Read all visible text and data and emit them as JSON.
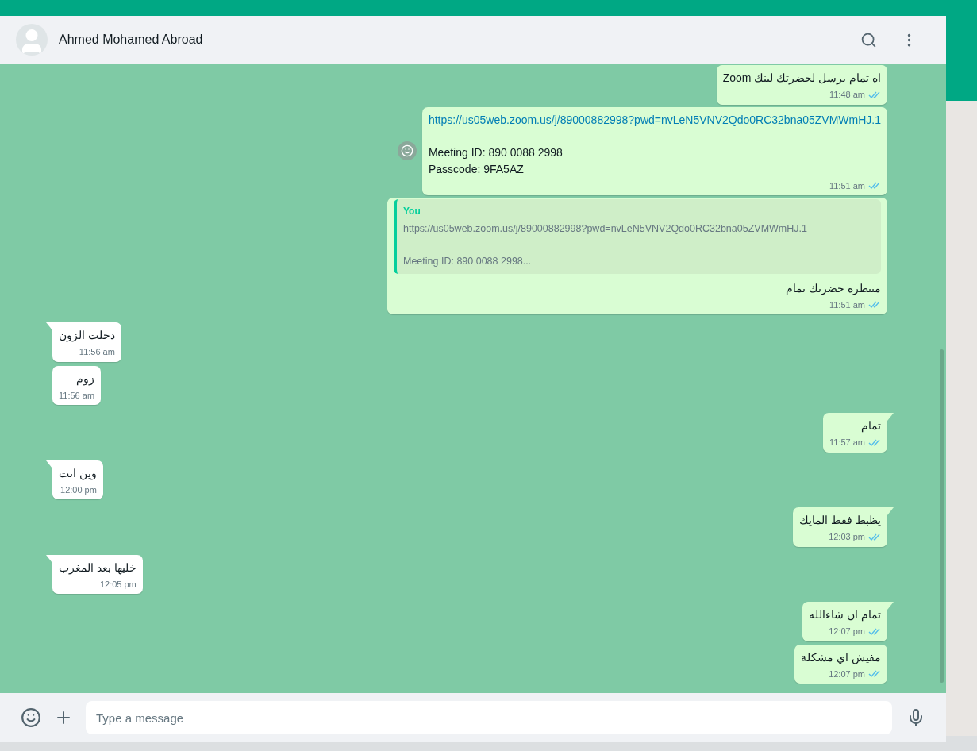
{
  "header": {
    "contact_name": "Ahmed Mohamed Abroad"
  },
  "messages": [
    {
      "kind": "text",
      "outgoing": true,
      "tail": false,
      "text": "اه تمام برسل لحضرتك لينك Zoom",
      "time": "11:48 am",
      "read": true
    },
    {
      "kind": "link",
      "outgoing": true,
      "tail": false,
      "link": "https://us05web.zoom.us/j/89000882998?pwd=nvLeN5VNV2Qdo0RC32bna05ZVMWmHJ.1",
      "lines": [
        "Meeting ID: 890 0088 2998",
        "Passcode: 9FA5AZ"
      ],
      "time": "11:51 am",
      "read": true,
      "reaction_button": true
    },
    {
      "kind": "reply",
      "outgoing": true,
      "tail": false,
      "quote_author": "You",
      "quote_lines": [
        "https://us05web.zoom.us/j/89000882998?pwd=nvLeN5VNV2Qdo0RC32bna05ZVMWmHJ.1",
        "Meeting ID: 890 0088 2998..."
      ],
      "text": "منتظرة حضرتك تمام",
      "time": "11:51 am",
      "read": true
    },
    {
      "kind": "text",
      "outgoing": false,
      "tail": true,
      "text": "دخلت الزون",
      "time": "11:56 am"
    },
    {
      "kind": "text",
      "outgoing": false,
      "tail": false,
      "text": "زوم",
      "time": "11:56 am"
    },
    {
      "kind": "text",
      "outgoing": true,
      "tail": true,
      "text": "تمام",
      "time": "11:57 am",
      "read": true
    },
    {
      "kind": "text",
      "outgoing": false,
      "tail": true,
      "text": "وين انت",
      "time": "12:00 pm"
    },
    {
      "kind": "text",
      "outgoing": true,
      "tail": true,
      "text": "يظبط فقط المايك",
      "time": "12:03 pm",
      "read": true
    },
    {
      "kind": "text",
      "outgoing": false,
      "tail": true,
      "text": "خليها بعد المغرب",
      "time": "12:05 pm"
    },
    {
      "kind": "text",
      "outgoing": true,
      "tail": true,
      "text": "تمام ان شاءالله",
      "time": "12:07 pm",
      "read": true
    },
    {
      "kind": "text",
      "outgoing": true,
      "tail": false,
      "text": "مفيش اي مشكلة",
      "time": "12:07 pm",
      "read": true
    }
  ],
  "composer": {
    "placeholder": "Type a message"
  }
}
